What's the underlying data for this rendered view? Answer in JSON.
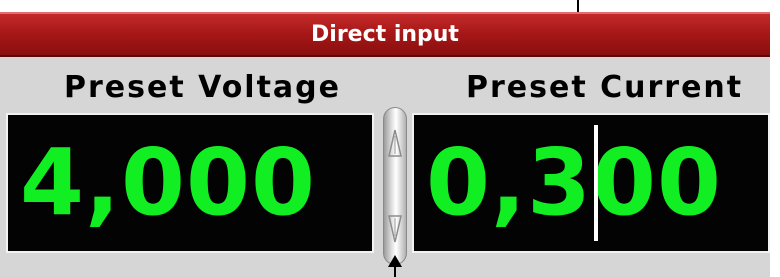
{
  "header": {
    "title": "Direct input"
  },
  "voltage": {
    "label": "Preset Voltage",
    "value": "4,000"
  },
  "current": {
    "label": "Preset Current",
    "value_before_caret": "0,3",
    "value_after_caret": "00"
  },
  "icons": {
    "spin_up": "chevron-up-icon",
    "spin_down": "chevron-down-icon",
    "pointer_top": "arrow-down-icon",
    "pointer_bottom": "arrow-up-icon"
  },
  "colors": {
    "header": "#a81818",
    "display_bg": "#030303",
    "digits": "#11ee22",
    "panel": "#d6d6d6"
  }
}
